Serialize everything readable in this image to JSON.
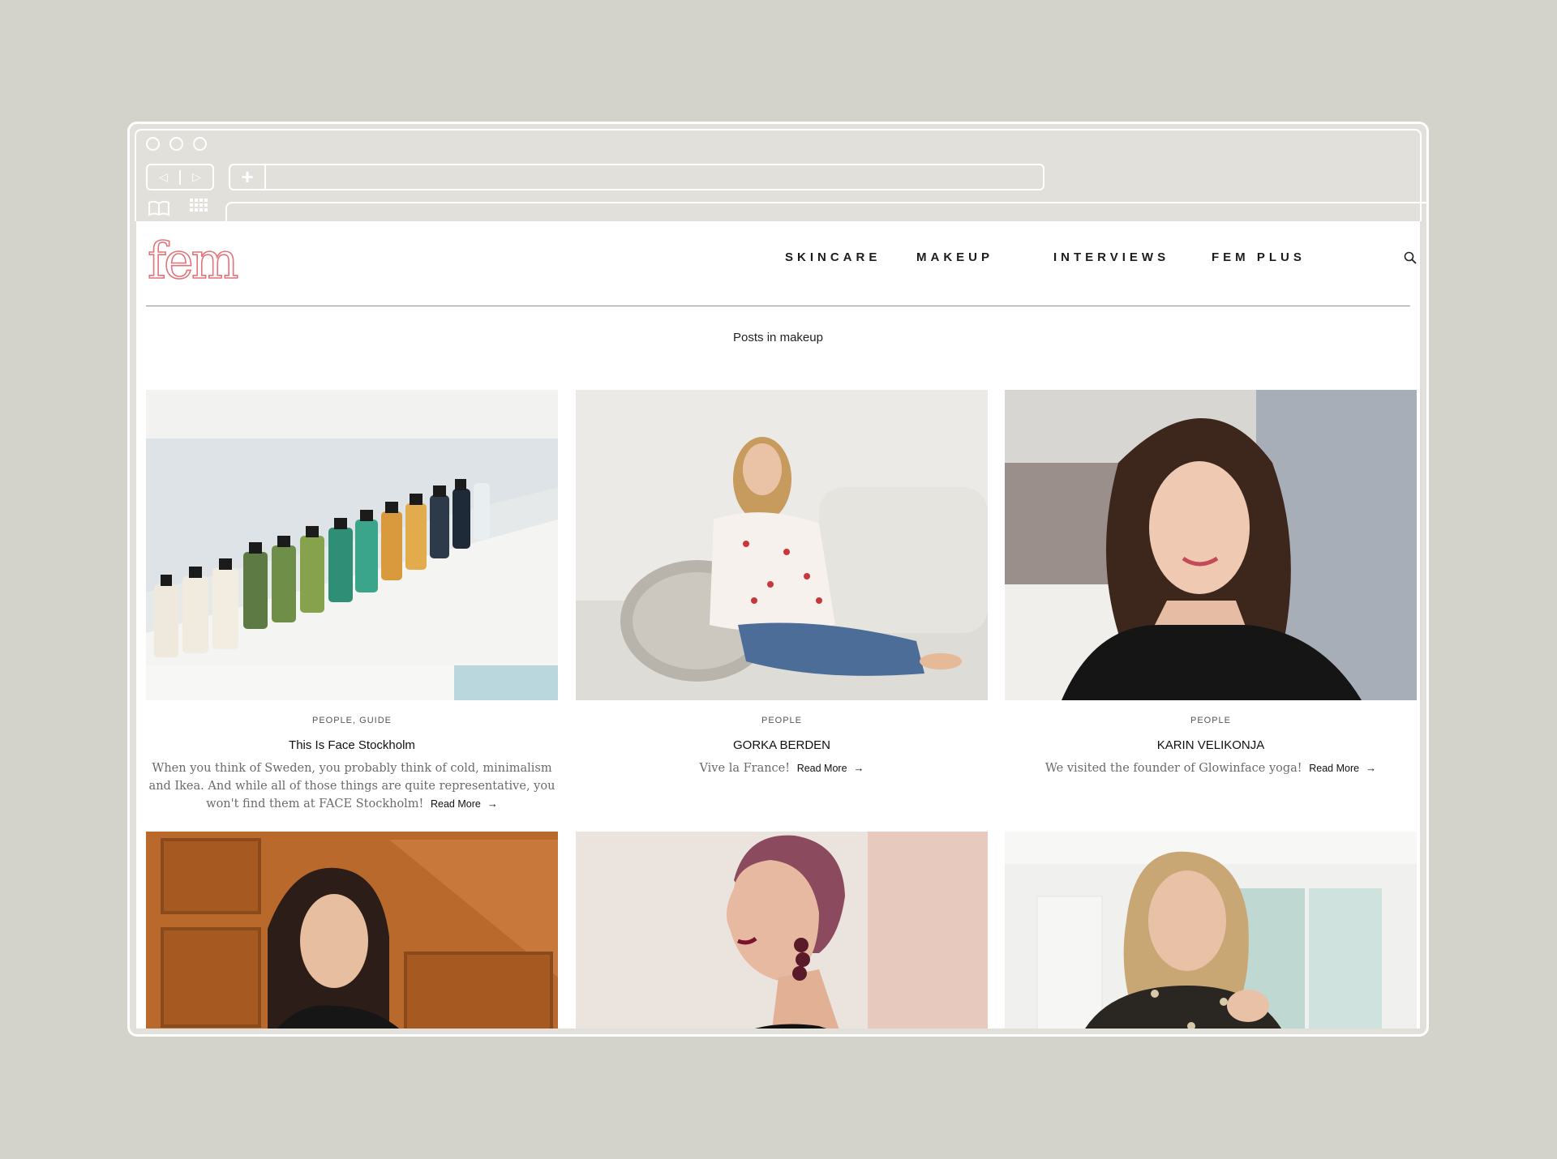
{
  "browser": {
    "nav_back": "◁",
    "nav_forward": "▷",
    "new_tab": "+"
  },
  "site": {
    "logo": "fem",
    "logo_color": "#e3737b"
  },
  "nav": {
    "items": [
      {
        "label": "SKINCARE"
      },
      {
        "label": "MAKEUP"
      },
      {
        "label": "INTERVIEWS"
      },
      {
        "label": "FEM PLUS"
      }
    ]
  },
  "main": {
    "section_title": "Posts in makeup",
    "posts": [
      {
        "category": "PEOPLE, GUIDE",
        "title": "This Is Face Stockholm",
        "excerpt": "When you think of Sweden, you probably think of cold, minimalism and Ikea. And while all of those things are quite representative, you won't find them at FACE Stockholm!",
        "read_more": "Read More",
        "image": "product-bottles-shelf"
      },
      {
        "category": "PEOPLE",
        "title": "GORKA BERDEN",
        "excerpt": "Vive la France!",
        "read_more": "Read More",
        "image": "woman-on-sofa"
      },
      {
        "category": "PEOPLE",
        "title": "KARIN VELIKONJA",
        "excerpt": "We visited the founder of Glowinface yoga!",
        "read_more": "Read More",
        "image": "woman-portrait-smiling"
      },
      {
        "image": "woman-wood-cabinet"
      },
      {
        "image": "woman-profile-earrings"
      },
      {
        "image": "woman-bright-room"
      }
    ]
  },
  "colors": {
    "background": "#d3d3cb",
    "chrome": "#e2e0da",
    "accent": "#e3737b"
  }
}
